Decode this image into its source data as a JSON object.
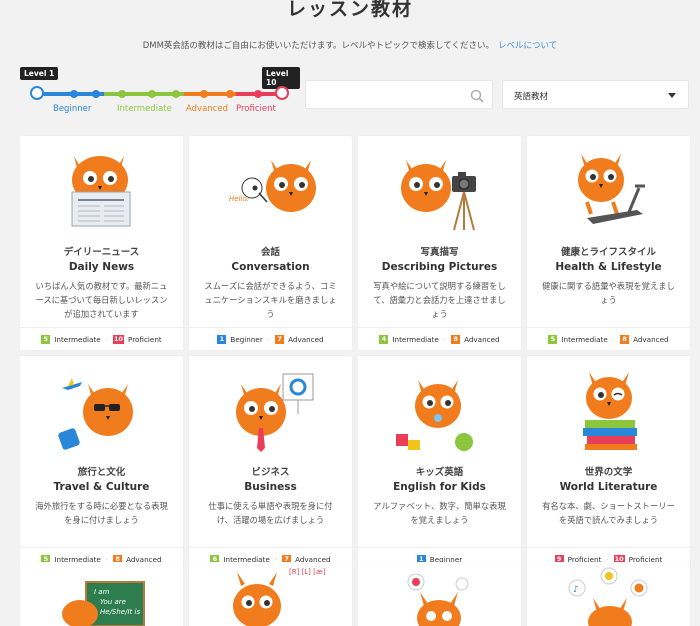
{
  "page": {
    "title": "レッスン教材",
    "intro": "DMM英会話の教材はご自由にお使いいただけます。レベルやトピックで検索してください。",
    "intro_link": "レベルについて"
  },
  "level_slider": {
    "start_badge": "Level 1",
    "end_badge": "Level 10",
    "labels": {
      "beginner": "Beginner",
      "intermediate": "Intermediate",
      "advanced": "Advanced",
      "proficient": "Proficient"
    },
    "colors": {
      "beginner": "#2a86d9",
      "intermediate": "#8cc63f",
      "advanced": "#f07c1e",
      "proficient": "#e83e5a"
    }
  },
  "search": {
    "placeholder": "",
    "value": "",
    "icon": "search-icon"
  },
  "category_select": {
    "selected": "英語教材",
    "icon": "chevron-down-icon"
  },
  "level_colors": {
    "Beginner": "#2a86d9",
    "Intermediate": "#8cc63f",
    "Advanced": "#f07c1e",
    "Proficient": "#e83e5a"
  },
  "cards": [
    {
      "jp": "デイリーニュース",
      "en": "Daily News",
      "desc": "いちばん人気の教材です。最新ニュースに基づいて毎日新しいレッスンが追加されています",
      "levels": [
        {
          "num": "5",
          "name": "Intermediate"
        },
        {
          "num": "10",
          "name": "Proficient"
        }
      ]
    },
    {
      "jp": "会話",
      "en": "Conversation",
      "desc": "スムーズに会話ができるよう、コミュニケーションスキルを磨きましょう",
      "levels": [
        {
          "num": "1",
          "name": "Beginner"
        },
        {
          "num": "7",
          "name": "Advanced"
        }
      ]
    },
    {
      "jp": "写真描写",
      "en": "Describing Pictures",
      "desc": "写真や絵について説明する練習をして、語彙力と会話力を上達させましょう",
      "levels": [
        {
          "num": "4",
          "name": "Intermediate"
        },
        {
          "num": "8",
          "name": "Advanced"
        }
      ]
    },
    {
      "jp": "健康とライフスタイル",
      "en": "Health & Lifestyle",
      "desc": "健康に関する語彙や表現を覚えましょう",
      "levels": [
        {
          "num": "5",
          "name": "Intermediate"
        },
        {
          "num": "8",
          "name": "Advanced"
        }
      ]
    },
    {
      "jp": "旅行と文化",
      "en": "Travel & Culture",
      "desc": "海外旅行をする時に必要となる表現を身に付けましょう",
      "levels": [
        {
          "num": "5",
          "name": "Intermediate"
        },
        {
          "num": "8",
          "name": "Advanced"
        }
      ]
    },
    {
      "jp": "ビジネス",
      "en": "Business",
      "desc": "仕事に使える単語や表現を身に付け、活躍の場を広げましょう",
      "levels": [
        {
          "num": "6",
          "name": "Intermediate"
        },
        {
          "num": "7",
          "name": "Advanced"
        }
      ]
    },
    {
      "jp": "キッズ英語",
      "en": "English for Kids",
      "desc": "アルファベット、数字、簡単な表現を覚えましょう",
      "levels": [
        {
          "num": "1",
          "name": "Beginner"
        }
      ]
    },
    {
      "jp": "世界の文学",
      "en": "World Literature",
      "desc": "有名な本、劇、ショートストーリーを英語で読んでみましょう",
      "levels": [
        {
          "num": "9",
          "name": "Proficient"
        },
        {
          "num": "10",
          "name": "Proficient"
        }
      ]
    }
  ],
  "partial_cards": {
    "board_lines": [
      "I am",
      "You are",
      "He/She/It is"
    ],
    "speech_text": "[R] [L]\n[æ]"
  }
}
